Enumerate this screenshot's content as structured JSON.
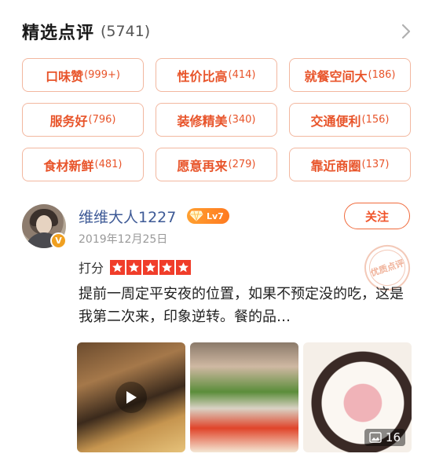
{
  "header": {
    "title": "精选点评",
    "count": "(5741)"
  },
  "tags": [
    {
      "label": "口味赞",
      "count": "(999+)"
    },
    {
      "label": "性价比高",
      "count": "(414)"
    },
    {
      "label": "就餐空间大",
      "count": "(186)"
    },
    {
      "label": "服务好",
      "count": "(796)"
    },
    {
      "label": "装修精美",
      "count": "(340)"
    },
    {
      "label": "交通便利",
      "count": "(156)"
    },
    {
      "label": "食材新鲜",
      "count": "(481)"
    },
    {
      "label": "愿意再来",
      "count": "(279)"
    },
    {
      "label": "靠近商圈",
      "count": "(137)"
    }
  ],
  "review": {
    "username": "维维大人1227",
    "level": "Lv7",
    "date": "2019年12月25日",
    "follow_label": "关注",
    "stamp_text": "优质点评",
    "badge": "V",
    "rating_label": "打分",
    "rating": 5,
    "content": "提前一周定平安夜的位置，如果不预定没的吃，这是我第二次来，印象逆转。餐的品…",
    "photo_count": "16"
  },
  "colors": {
    "accent": "#e8542a",
    "tag_border": "#f2b79f",
    "username": "#3e5a96",
    "star": "#f03d2a"
  },
  "icons": {
    "header_arrow": "chevron-right-icon",
    "level": "diamond-icon",
    "video": "play-icon",
    "photos": "image-icon"
  }
}
